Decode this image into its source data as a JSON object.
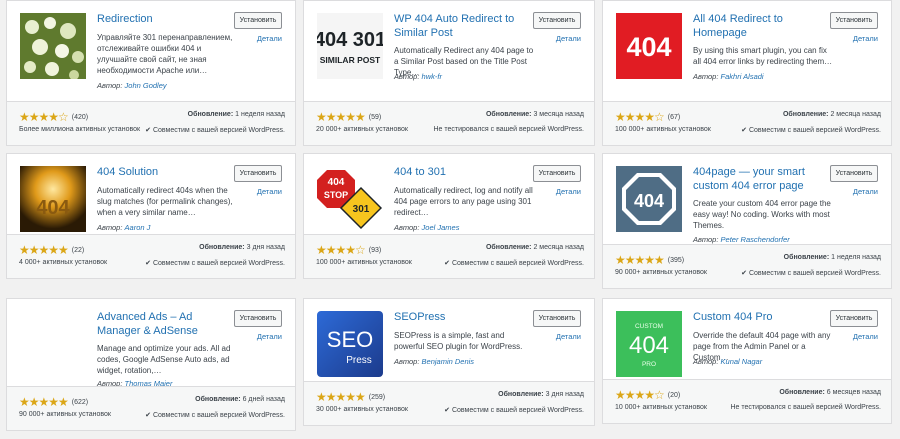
{
  "plugins": [
    {
      "title": "Redirection",
      "desc": "Управляйте 301 перенаправлением, отслеживайте ошибки 404 и улучшайте свой сайт, не зная необходимости Apache или…",
      "author_label": "Автор:",
      "author": "John Godley",
      "install": "Установить",
      "details": "Детали",
      "stars": "★★★★☆",
      "ratings": "(420)",
      "updated_label": "Обновление:",
      "updated": "1 неделя назад",
      "installs": "Более миллиона активных установок",
      "compat": "✔ Совместим с вашей версией WordPress."
    },
    {
      "title": "WP 404 Auto Redirect to Similar Post",
      "desc": "Automatically Redirect any 404 page to a Similar Post based on the Title Post Type…",
      "author_label": "Автор:",
      "author": "hwk-fr",
      "install": "Установить",
      "details": "Детали",
      "stars": "★★★★★",
      "ratings": "(59)",
      "updated_label": "Обновление:",
      "updated": "3 месяца назад",
      "installs": "20 000+ активных установок",
      "compat": "Не тестировался с вашей версией WordPress.",
      "thumb_text1": "404 301",
      "thumb_text2": "SIMILAR POST"
    },
    {
      "title": "All 404 Redirect to Homepage",
      "desc": "By using this smart plugin, you can fix all 404 error links by redirecting them…",
      "author_label": "Автор:",
      "author": "Fakhri Alsadi",
      "install": "Установить",
      "details": "Детали",
      "stars": "★★★★☆",
      "ratings": "(67)",
      "updated_label": "Обновление:",
      "updated": "2 месяца назад",
      "installs": "100 000+ активных установок",
      "compat": "✔ Совместим с вашей версией WordPress.",
      "thumb_text1": "404"
    },
    {
      "title": "404 Solution",
      "desc": "Automatically redirect 404s when the slug matches (for permalink changes), when a very similar name…",
      "author_label": "Автор:",
      "author": "Aaron J",
      "install": "Установить",
      "details": "Детали",
      "stars": "★★★★★",
      "ratings": "(22)",
      "updated_label": "Обновление:",
      "updated": "3 дня назад",
      "installs": "4 000+ активных установок",
      "compat": "✔ Совместим с вашей версией WordPress.",
      "thumb_text1": "404"
    },
    {
      "title": "404 to 301",
      "desc": "Automatically redirect, log and notify all 404 page errors to any page using 301 redirect…",
      "author_label": "Автор:",
      "author": "Joel James",
      "install": "Установить",
      "details": "Детали",
      "stars": "★★★★☆",
      "ratings": "(93)",
      "updated_label": "Обновление:",
      "updated": "2 месяца назад",
      "installs": "100 000+ активных установок",
      "compat": "✔ Совместим с вашей версией WordPress.",
      "thumb_text1": "404",
      "thumb_text2": "STOP",
      "thumb_text3": "301"
    },
    {
      "title": "404page — your smart custom 404 error page",
      "desc": "Create your custom 404 error page the easy way! No coding. Works with most Themes.",
      "author_label": "Автор:",
      "author": "Peter Raschendorfer",
      "install": "Установить",
      "details": "Детали",
      "stars": "★★★★★",
      "ratings": "(395)",
      "updated_label": "Обновление:",
      "updated": "1 неделя назад",
      "installs": "90 000+ активных установок",
      "compat": "✔ Совместим с вашей версией WordPress.",
      "thumb_text1": "404"
    },
    {
      "title": "Advanced Ads – Ad Manager & AdSense",
      "desc": "Manage and optimize your ads. All ad codes, Google AdSense Auto ads, ad widget, rotation,…",
      "author_label": "Автор:",
      "author": "Thomas Maier",
      "install": "Установить",
      "details": "Детали",
      "stars": "★★★★★",
      "ratings": "(622)",
      "updated_label": "Обновление:",
      "updated": "6 дней назад",
      "installs": "90 000+ активных установок",
      "compat": "✔ Совместим с вашей версией WordPress."
    },
    {
      "title": "SEOPress",
      "desc": "SEOPress is a simple, fast and powerful SEO plugin for WordPress.",
      "author_label": "Автор:",
      "author": "Benjamin Denis",
      "install": "Установить",
      "details": "Детали",
      "stars": "★★★★★",
      "ratings": "(259)",
      "updated_label": "Обновление:",
      "updated": "3 дня назад",
      "installs": "30 000+ активных установок",
      "compat": "✔ Совместим с вашей версией WordPress.",
      "thumb_text1": "SEO",
      "thumb_text2": "Press"
    },
    {
      "title": "Custom 404 Pro",
      "desc": "Override the default 404 page with any page from the Admin Panel or a Custom…",
      "author_label": "Автор:",
      "author": "Kunal Nagar",
      "install": "Установить",
      "details": "Детали",
      "stars": "★★★★☆",
      "ratings": "(20)",
      "updated_label": "Обновление:",
      "updated": "6 месяцев назад",
      "installs": "10 000+ активных установок",
      "compat": "Не тестировался с вашей версией WordPress.",
      "thumb_text1": "CUSTOM",
      "thumb_text2": "404",
      "thumb_text3": "PRO"
    }
  ]
}
